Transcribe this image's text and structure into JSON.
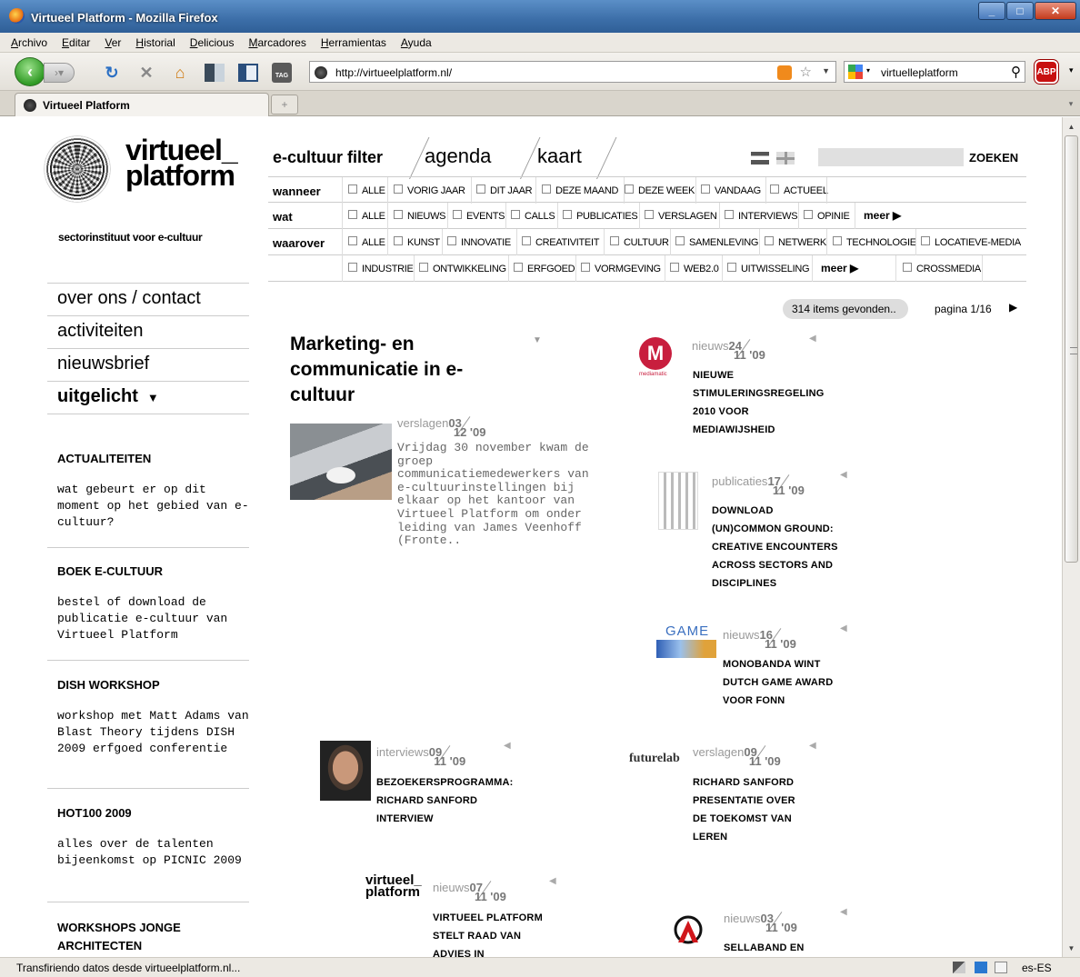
{
  "browser": {
    "title": "Virtueel Platform - Mozilla Firefox",
    "menu": [
      "Archivo",
      "Editar",
      "Ver",
      "Historial",
      "Delicious",
      "Marcadores",
      "Herramientas",
      "Ayuda"
    ],
    "url": "http://virtueelplatform.nl/",
    "search_value": "virtuelleplatform",
    "tab_label": "Virtueel Platform",
    "status_text": "Transfiriendo datos desde virtueelplatform.nl...",
    "locale": "es-ES",
    "icons": [
      "back-arrow",
      "forward-arrow",
      "reload",
      "stop",
      "home",
      "rss",
      "star",
      "google",
      "magnifier",
      "adblock"
    ]
  },
  "site": {
    "logo_line1": "virtueel_",
    "logo_line2": "platform",
    "tagline": "sectorinstituut voor e-cultuur",
    "nav": [
      "over ons / contact",
      "activiteiten",
      "nieuwsbrief",
      "uitgelicht"
    ],
    "filter_tabs": [
      "e-cultuur filter",
      "agenda",
      "kaart"
    ],
    "search_button": "ZOEKEN",
    "filters": {
      "wanneer_label": "wanneer",
      "wanneer": [
        "ALLE",
        "VORIG JAAR",
        "DIT JAAR",
        "DEZE MAAND",
        "DEZE WEEK",
        "VANDAAG",
        "ACTUEEL"
      ],
      "wat_label": "wat",
      "wat": [
        "ALLE",
        "NIEUWS",
        "EVENTS",
        "CALLS",
        "PUBLICATIES",
        "VERSLAGEN",
        "INTERVIEWS",
        "OPINIE"
      ],
      "waarover_label": "waarover",
      "waarover": [
        "ALLE",
        "KUNST",
        "INNOVATIE",
        "CREATIVITEIT",
        "CULTUUR",
        "SAMENLEVING",
        "NETWERK",
        "TECHNOLOGIE",
        "LOCATIEVE-MEDIA"
      ],
      "waarover2": [
        "INDUSTRIE",
        "ONTWIKKELING",
        "ERFGOED",
        "VORMGEVING",
        "WEB2.0",
        "UITWISSELING",
        "CROSSMEDIA"
      ],
      "more": "meer"
    },
    "results": {
      "found": "314 items gevonden..",
      "page": "pagina 1/16"
    },
    "sidebar": [
      {
        "title": "ACTUALITEITEN",
        "text": "wat gebeurt er op dit moment op het gebied van e-cultuur?"
      },
      {
        "title": "BOEK E-CULTUUR",
        "text": "bestel of download de publicatie e-cultuur van Virtueel Platform"
      },
      {
        "title": "DISH WORKSHOP",
        "text": "workshop met Matt Adams van Blast Theory tijdens DISH 2009 erfgoed conferentie"
      },
      {
        "title": "HOT100 2009",
        "text": "alles over de talenten bijeenkomst op PICNIC 2009"
      },
      {
        "title": "WORKSHOPS JONGE ARCHITECTEN",
        "text": ""
      }
    ],
    "featured": {
      "title": "Marketing- en communicatie in e-cultuur",
      "type": "verslagen",
      "day": "03",
      "month": "12 '09",
      "excerpt": "Vrijdag 30 november kwam de groep communicatiemedewerkers van e-cultuurinstellingen bij elkaar op het kantoor van Virtueel Platform om onder leiding van James Veenhoff (Fronte.."
    },
    "items": [
      {
        "type": "nieuws",
        "day": "24",
        "month": "11 '09",
        "lines": [
          "NIEUWE",
          "STIMULERINGSREGELING",
          "2010 VOOR",
          "MEDIAWIJSHEID"
        ],
        "thumb_label": "mediamatic"
      },
      {
        "type": "publicaties",
        "day": "17",
        "month": "11 '09",
        "lines": [
          "DOWNLOAD",
          "(UN)COMMON GROUND:",
          "CREATIVE ENCOUNTERS",
          "ACROSS SECTORS AND",
          "DISCIPLINES"
        ]
      },
      {
        "type": "nieuws",
        "day": "16",
        "month": "11 '09",
        "lines": [
          "MONOBANDA WINT",
          "DUTCH GAME AWARD",
          "VOOR FONN"
        ],
        "thumb_label": "GAME"
      },
      {
        "type": "interviews",
        "day": "09",
        "month": "11 '09",
        "lines": [
          "BEZOEKERSPROGRAMMA:",
          "RICHARD SANFORD",
          "INTERVIEW"
        ]
      },
      {
        "type": "verslagen",
        "day": "09",
        "month": "11 '09",
        "lines": [
          "RICHARD SANFORD",
          "PRESENTATIE OVER",
          "DE TOEKOMST VAN",
          "LEREN"
        ],
        "thumb_label": "futurelab"
      },
      {
        "type": "nieuws",
        "day": "07",
        "month": "11 '09",
        "lines": [
          "VIRTUEEL PLATFORM",
          "STELT RAAD VAN",
          "ADVIES IN"
        ],
        "thumb_label": "virtueel_ platform"
      },
      {
        "type": "nieuws",
        "day": "03",
        "month": "11 '09",
        "lines": [
          "SELLABAND EN"
        ]
      }
    ]
  }
}
